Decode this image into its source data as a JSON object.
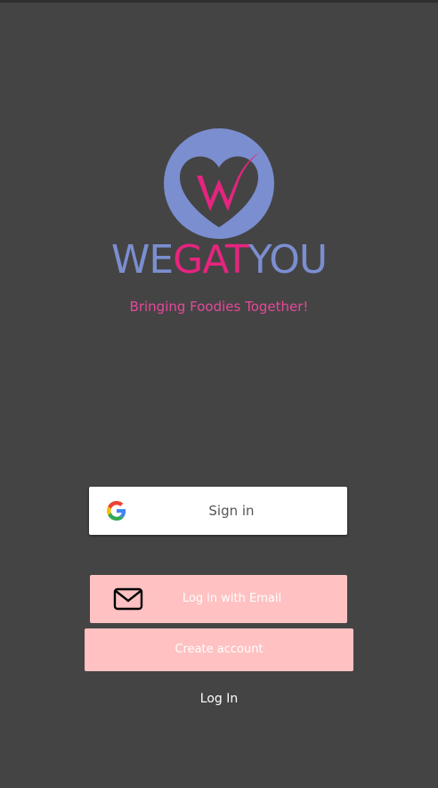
{
  "brand": {
    "name_part1": "WE",
    "name_part2": "GAT",
    "name_part3": "YOU",
    "tagline": "Bringing Foodies Together!",
    "color_primary": "#7b8ed0",
    "color_accent": "#e6247f",
    "logo_icon": "heart-w-logo-icon"
  },
  "auth": {
    "google_button_label": "Sign in",
    "google_icon": "google-icon",
    "email_button_label": "Log in with Email",
    "email_icon": "mail-icon",
    "create_account_label": "Create account",
    "login_link_label": "Log In",
    "button_color": "#ffc1c1"
  }
}
